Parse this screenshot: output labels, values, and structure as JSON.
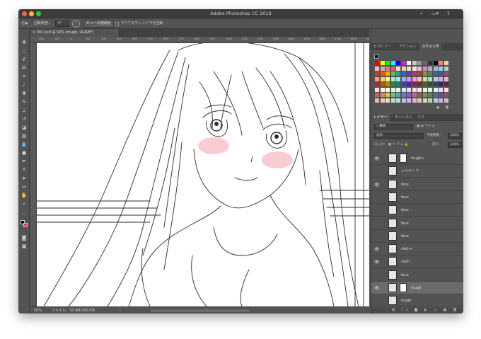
{
  "window": {
    "title": "Adobe Photoshop CC 2019",
    "traffic_lights": [
      "#ff5f57",
      "#febc2e",
      "#28c840"
    ]
  },
  "options_bar": {
    "tool_icon": "rotate-view-icon",
    "rotation_label": "回転角度：",
    "rotation_value": "0°",
    "reset_view_label": "ビューの初期化",
    "all_windows_label": "すべてのウィンドウを回転"
  },
  "document": {
    "tab_label": "001.psd @ 50% (rough, RGB/8*)",
    "ruler_ticks": [
      "200",
      "100",
      "0",
      "100",
      "200",
      "300",
      "400",
      "500",
      "600",
      "700",
      "800",
      "900",
      "1000",
      "1100",
      "1200",
      "1300",
      "1400",
      "1500",
      "1600",
      "1700",
      "1800",
      "1900"
    ]
  },
  "status": {
    "zoom": "50%",
    "file_info": "ファイル：33.9M/395.6M",
    "arrow": "›"
  },
  "panels": {
    "top_tabs": [
      "ヒストリー",
      "アクション",
      "スウォッチ"
    ],
    "active_top_tab": 2,
    "layers_tabs": [
      "レイヤー",
      "チャンネル",
      "パス"
    ],
    "filter_kind": "種類",
    "blend_mode": "通常",
    "opacity_label": "不透明度：",
    "opacity_value": "100%",
    "lock_label": "ロック：",
    "fill_label": "塗り：",
    "fill_value": "100%",
    "layers": [
      {
        "name": "rough+",
        "visible": true,
        "mask": true,
        "selected": false
      },
      {
        "name": "レイヤー 7",
        "visible": false,
        "mask": false,
        "selected": false
      },
      {
        "name": "face",
        "visible": true,
        "mask": false,
        "selected": false
      },
      {
        "name": "face",
        "visible": false,
        "mask": false,
        "selected": false
      },
      {
        "name": "face",
        "visible": false,
        "mask": false,
        "selected": false
      },
      {
        "name": "face",
        "visible": false,
        "mask": false,
        "selected": false
      },
      {
        "name": "face",
        "visible": false,
        "mask": false,
        "selected": false
      },
      {
        "name": "cloth+",
        "visible": true,
        "mask": false,
        "selected": false
      },
      {
        "name": "cloth",
        "visible": true,
        "mask": false,
        "selected": false
      },
      {
        "name": "face",
        "visible": false,
        "mask": false,
        "selected": false
      },
      {
        "name": "rough",
        "visible": true,
        "mask": true,
        "selected": true
      },
      {
        "name": "rough",
        "visible": false,
        "mask": false,
        "selected": false
      }
    ]
  },
  "swatch_colors": [
    "#ff0000",
    "#ffff00",
    "#00ff00",
    "#00ffff",
    "#0000ff",
    "#ff00ff",
    "#ffffff",
    "#cccccc",
    "#999999",
    "#666666",
    "#333333",
    "#000000",
    "#ff8080",
    "#ffcc99",
    "#f2c2c2",
    "#e6a3a3",
    "#d98080",
    "#cc6666",
    "#f0e0d0",
    "#e8d0b8",
    "#ffd9b3",
    "#ffe6cc",
    "#e6b3cc",
    "#d98cb3",
    "#c2a3d9",
    "#a3b3e6",
    "#99ccdd",
    "#a3d9c2",
    "#cc3333",
    "#e65c00",
    "#e6b800",
    "#66b366",
    "#339999",
    "#3366cc",
    "#6633cc",
    "#b3337a",
    "#994d33",
    "#8c8c3f",
    "#4d8c4d",
    "#336b8c",
    "#5c4d8c",
    "#8c4d70",
    "#ff9999",
    "#ffcc66",
    "#ffff99",
    "#b3e6b3",
    "#99e6e6",
    "#99b3ff",
    "#cc99ff",
    "#ff99cc",
    "#e6ccb3",
    "#d9d9b3",
    "#b3d9b3",
    "#b3cce6",
    "#ccb3e6",
    "#e6b3d1",
    "#b32424",
    "#b35900",
    "#b38f00",
    "#2d8a2d",
    "#1f7a7a",
    "#1f4db3",
    "#4d1fb3",
    "#8a1f5c",
    "#6b3320",
    "#5c5c20",
    "#205c20",
    "#20465c",
    "#3a205c",
    "#5c2040",
    "#ffe0e0",
    "#ffefd9",
    "#fffbd9",
    "#e0f5e0",
    "#d9f5f5",
    "#d9e4ff",
    "#ecd9ff",
    "#ffd9ec",
    "#f5ebe0",
    "#f0f0e0",
    "#e0f0e0",
    "#e0ebf5",
    "#ebe0f5",
    "#f5e0eb",
    "#c06060",
    "#d68a60",
    "#d6c060",
    "#80b380",
    "#60a6a6",
    "#6080c0",
    "#8060c0",
    "#c06098",
    "#8a6650",
    "#8a8a50",
    "#508a50",
    "#50708a",
    "#66508a",
    "#8a5070",
    "#e8b4b4",
    "#e8c8b4",
    "#e8dcb4",
    "#c4dcc4",
    "#b4dcdc",
    "#b4c4e8",
    "#c8b4e8",
    "#e8b4d4",
    "#dcc8b4",
    "#d4d4b4",
    "#b4d4b4",
    "#b4c8dc",
    "#c8b4dc",
    "#dcb4c8"
  ],
  "canvas": {
    "background": "#ffffff",
    "line_color": "#2a2a2a",
    "blush_color": "#f4a3ae"
  }
}
